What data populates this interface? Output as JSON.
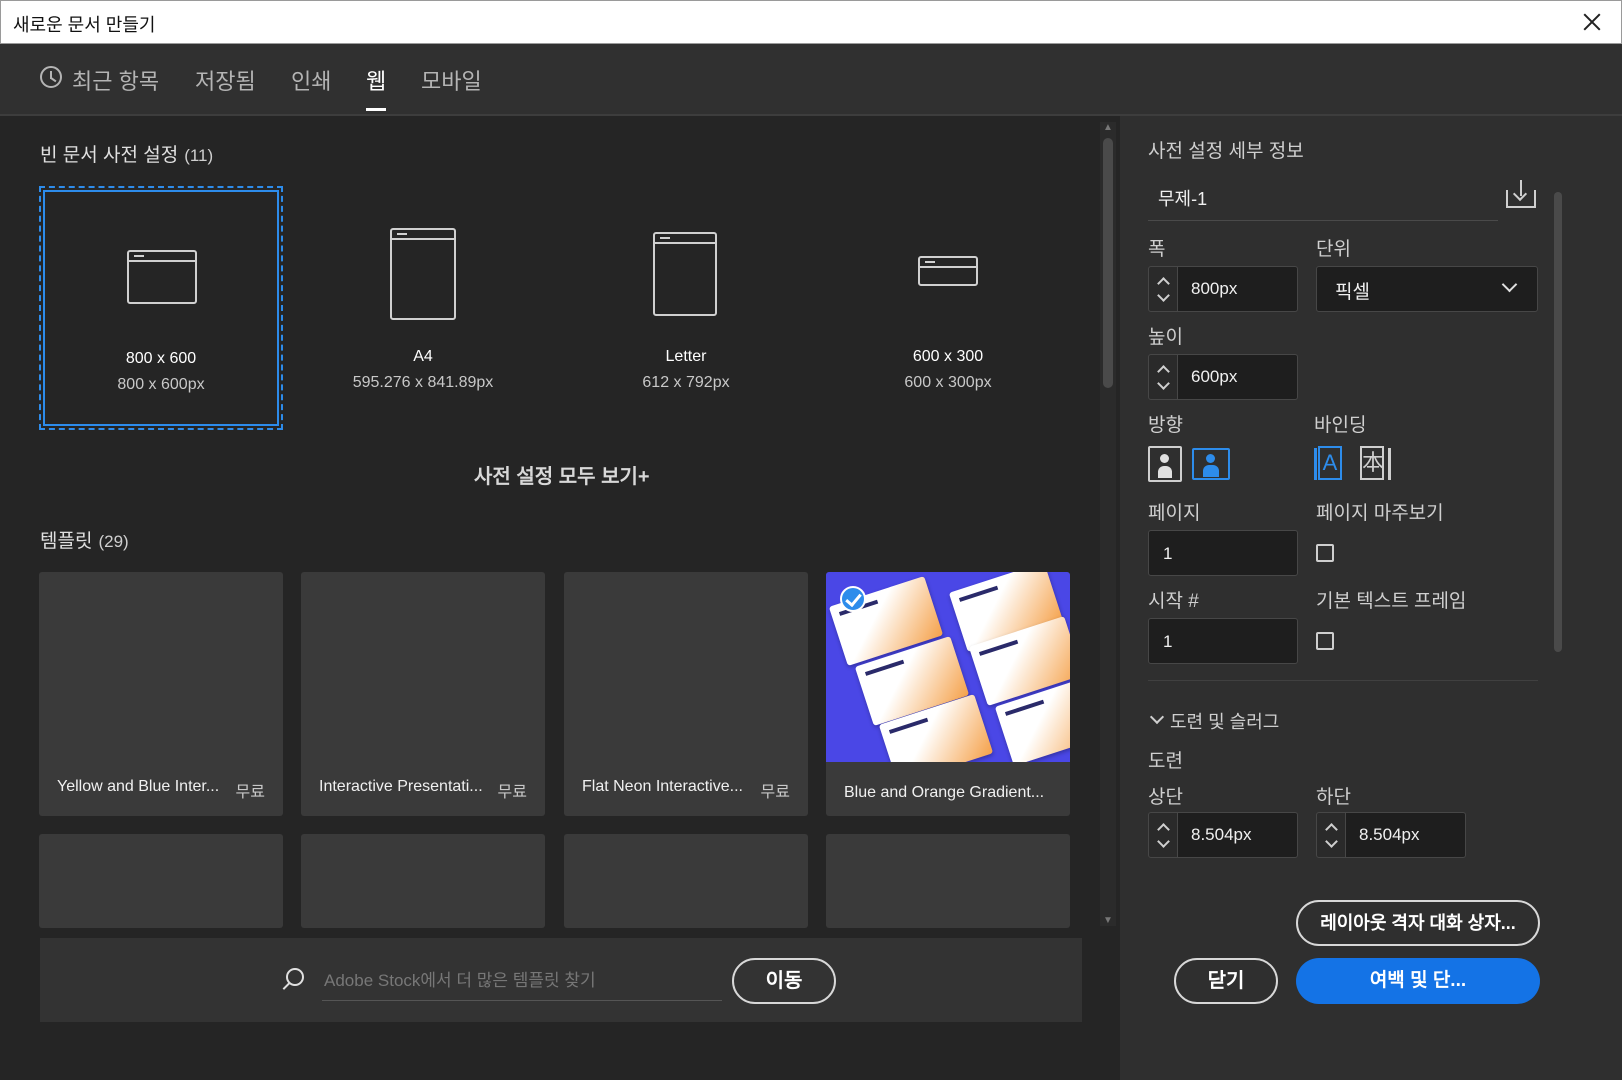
{
  "window": {
    "title": "새로운 문서 만들기"
  },
  "tabs": [
    {
      "label": "최근 항목"
    },
    {
      "label": "저장됨"
    },
    {
      "label": "인쇄"
    },
    {
      "label": "웹",
      "active": true
    },
    {
      "label": "모바일"
    }
  ],
  "presets_section": {
    "title": "빈 문서 사전 설정",
    "count": "(11)",
    "items": [
      {
        "name": "800 x 600",
        "size": "800 x 600px",
        "selected": true
      },
      {
        "name": "A4",
        "size": "595.276 x 841.89px"
      },
      {
        "name": "Letter",
        "size": "612 x 792px"
      },
      {
        "name": "600 x 300",
        "size": "600 x 300px"
      }
    ],
    "see_all": "사전 설정 모두 보기+"
  },
  "templates_section": {
    "title": "템플릿",
    "count": "(29)",
    "items": [
      {
        "name": "Yellow and Blue Inter...",
        "badge": "무료"
      },
      {
        "name": "Interactive Presentati...",
        "badge": "무료"
      },
      {
        "name": "Flat Neon Interactive...",
        "badge": "무료"
      },
      {
        "name": "Blue and Orange Gradient...",
        "badge": "",
        "selected": true
      }
    ]
  },
  "stock_search": {
    "placeholder": "Adobe Stock에서 더 많은 템플릿 찾기",
    "go_label": "이동"
  },
  "details": {
    "heading": "사전 설정 세부 정보",
    "doc_name": "무제-1",
    "width_label": "폭",
    "width_value": "800px",
    "units_label": "단위",
    "units_value": "픽셀",
    "height_label": "높이",
    "height_value": "600px",
    "orientation_label": "방향",
    "binding_label": "바인딩",
    "binding_ltr_glyph": "A",
    "binding_rtl_glyph": "本",
    "pages_label": "페이지",
    "pages_value": "1",
    "facing_label": "페이지 마주보기",
    "start_label": "시작 #",
    "start_value": "1",
    "primary_frame_label": "기본 텍스트 프레임",
    "bleed_section_label": "도련 및 슬러그",
    "bleed_label": "도련",
    "top_label": "상단",
    "top_value": "8.504px",
    "bottom_label": "하단",
    "bottom_value": "8.504px"
  },
  "footer": {
    "layout_grid_button": "레이아웃 격자 대화 상자...",
    "close_button": "닫기",
    "margins_button": "여백 및 단..."
  },
  "colors": {
    "accent": "#2d8ceb",
    "primary_button": "#1473e6",
    "background": "#252525",
    "panel": "#2f2f2f"
  }
}
